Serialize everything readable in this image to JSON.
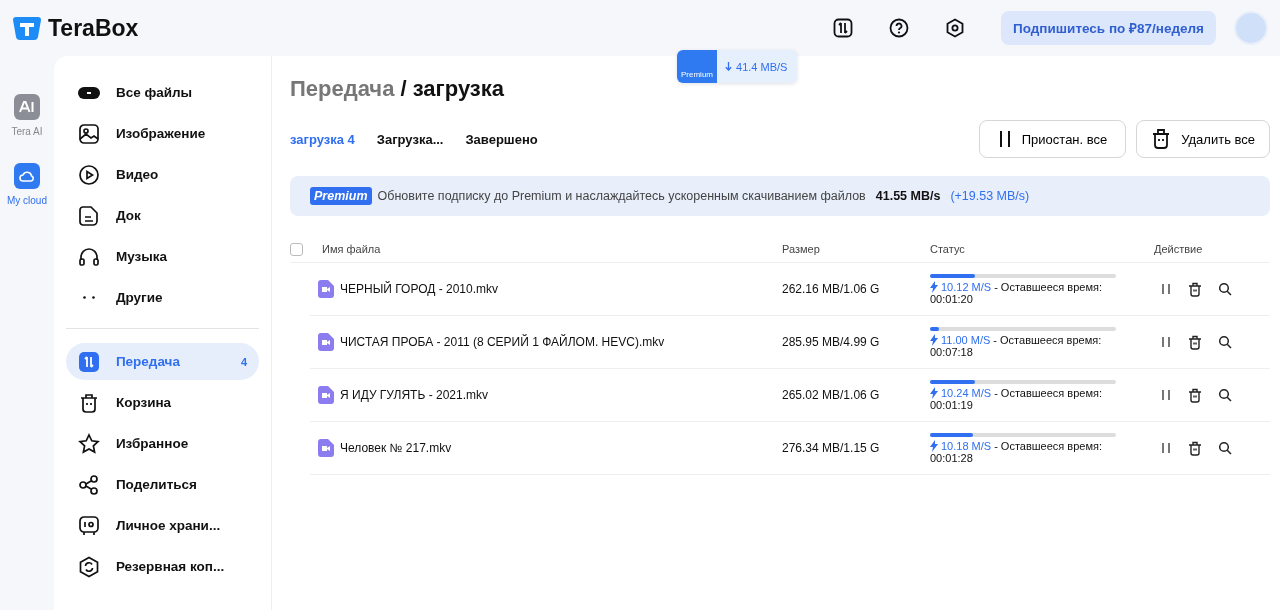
{
  "app": {
    "logo_text": "TeraBox"
  },
  "topbar": {
    "subscribe": "Подпишитесь по ₽87/неделя"
  },
  "speed_badge": {
    "tier": "Premium",
    "speed": "41.4 MB/S"
  },
  "rail": [
    {
      "label": "Tera AI",
      "selected": false
    },
    {
      "label": "My cloud",
      "selected": true
    }
  ],
  "sidebar": {
    "items": [
      {
        "label": "Все файлы",
        "selected": false
      },
      {
        "label": "Изображение",
        "selected": false
      },
      {
        "label": "Видео",
        "selected": false
      },
      {
        "label": "Док",
        "selected": false
      },
      {
        "label": "Музыка",
        "selected": false
      },
      {
        "label": "Другие",
        "selected": false
      }
    ],
    "items2": [
      {
        "label": "Передача",
        "selected": true,
        "count": "4"
      },
      {
        "label": "Корзина",
        "selected": false
      },
      {
        "label": "Избранное",
        "selected": false
      },
      {
        "label": "Поделиться",
        "selected": false
      },
      {
        "label": "Личное храни...",
        "selected": false
      },
      {
        "label": "Резервная коп...",
        "selected": false
      }
    ]
  },
  "breadcrumb": {
    "parent": "Передача",
    "separator": "/",
    "current": "загрузка"
  },
  "tabs": [
    {
      "label": "загрузка 4",
      "selected": true
    },
    {
      "label": "Загрузка...",
      "selected": false
    },
    {
      "label": "Завершено",
      "selected": false
    }
  ],
  "buttons": [
    "Приостан. все",
    "Удалить все"
  ],
  "banner": {
    "badge": "Premium",
    "text": "Обновите подписку до Premium и наслаждайтесь ускоренным скачиванием файлов",
    "speed": "41.55 MB/s",
    "boost": "(+19.53 MB/s)"
  },
  "table": {
    "checked": false,
    "columns": [
      "Имя файла",
      "Размер",
      "Статус",
      "Действие"
    ],
    "rows": [
      {
        "name": "ЧЕРНЫЙ ГОРОД - 2010.mkv",
        "size": "262.16 MB/1.06 G",
        "level": 0.24,
        "speed": "10.12 M/S",
        "remaining": "- Оставшееся время:",
        "time": "00:01:20"
      },
      {
        "name": "ЧИСТАЯ ПРОБА - 2011 (8 СЕРИЙ 1 ФАЙЛОМ. HEVC).mkv",
        "size": "285.95 MB/4.99 G",
        "level": 0.05,
        "speed": "11.00 M/S",
        "remaining": "- Оставшееся время:",
        "time": "00:07:18"
      },
      {
        "name": "Я ИДУ ГУЛЯТЬ - 2021.mkv",
        "size": "265.02 MB/1.06 G",
        "level": 0.24,
        "speed": "10.24 M/S",
        "remaining": "- Оставшееся время:",
        "time": "00:01:19"
      },
      {
        "name": "Человек № 217.mkv",
        "size": "276.34 MB/1.15 G",
        "level": 0.23,
        "speed": "10.18 M/S",
        "remaining": "- Оставшееся время:",
        "time": "00:01:28"
      }
    ]
  }
}
